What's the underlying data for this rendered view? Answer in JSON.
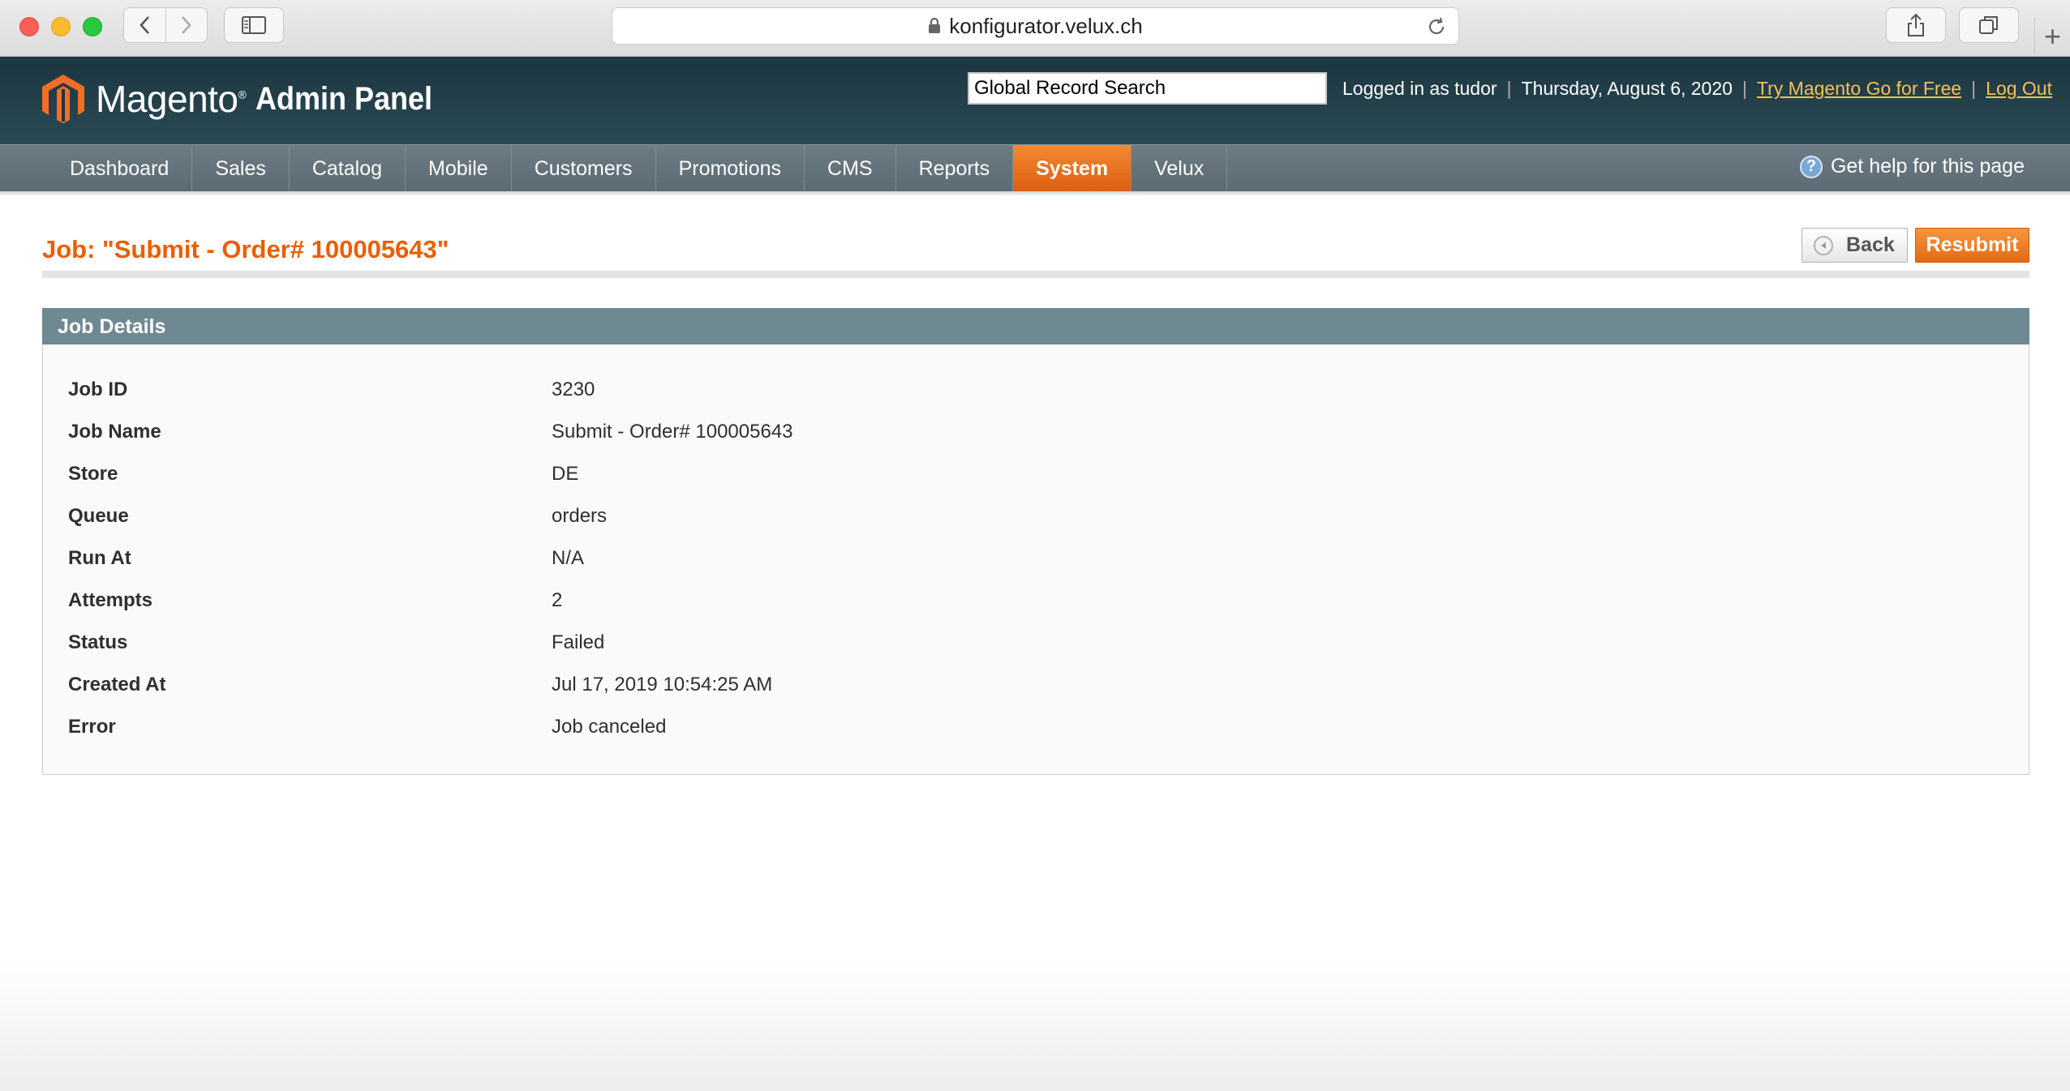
{
  "browser": {
    "url": "konfigurator.velux.ch"
  },
  "header": {
    "logo_text": "Magento",
    "logo_sub": "Admin Panel",
    "search_value": "Global Record Search",
    "logged_in": "Logged in as tudor",
    "date": "Thursday, August 6, 2020",
    "try_link": "Try Magento Go for Free",
    "logout_link": "Log Out"
  },
  "nav": {
    "items": [
      {
        "label": "Dashboard"
      },
      {
        "label": "Sales"
      },
      {
        "label": "Catalog"
      },
      {
        "label": "Mobile"
      },
      {
        "label": "Customers"
      },
      {
        "label": "Promotions"
      },
      {
        "label": "CMS"
      },
      {
        "label": "Reports"
      },
      {
        "label": "System"
      },
      {
        "label": "Velux"
      }
    ],
    "active": "System",
    "help_label": "Get help for this page"
  },
  "page": {
    "title": "Job: \"Submit - Order# 100005643\"",
    "back_label": "Back",
    "resubmit_label": "Resubmit"
  },
  "job_details": {
    "heading": "Job Details",
    "rows": [
      {
        "label": "Job ID",
        "value": "3230"
      },
      {
        "label": "Job Name",
        "value": "Submit - Order# 100005643"
      },
      {
        "label": "Store",
        "value": "DE"
      },
      {
        "label": "Queue",
        "value": "orders"
      },
      {
        "label": "Run At",
        "value": "N/A"
      },
      {
        "label": "Attempts",
        "value": "2"
      },
      {
        "label": "Status",
        "value": "Failed"
      },
      {
        "label": "Created At",
        "value": "Jul 17, 2019 10:54:25 AM"
      },
      {
        "label": "Error",
        "value": "Job canceled"
      }
    ]
  },
  "colors": {
    "accent_orange": "#eb5e00",
    "header_dark": "#1c3640",
    "nav_gray": "#66747d",
    "panel_head": "#6f8992",
    "link_yellow": "#f4c256"
  }
}
